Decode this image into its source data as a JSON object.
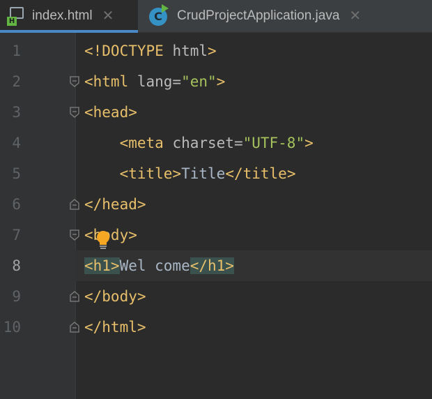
{
  "tabs": [
    {
      "label": "index.html",
      "icon": "html-file-icon",
      "active": true,
      "badge": "H"
    },
    {
      "label": "CrudProjectApplication.java",
      "icon": "java-class-icon",
      "active": false,
      "badge": "C"
    }
  ],
  "editor": {
    "current_line": 8,
    "line_numbers": [
      "1",
      "2",
      "3",
      "4",
      "5",
      "6",
      "7",
      "8",
      "9",
      "10"
    ],
    "lines": [
      {
        "tag_open": "<!DOCTYPE",
        "attr": " html",
        "tag_close": ">"
      },
      {
        "tag_open": "<html",
        "attr": " lang=",
        "str": "\"en\"",
        "tag_close": ">"
      },
      {
        "tag": "<head>"
      },
      {
        "indent": "    ",
        "tag_open": "<meta",
        "attr": " charset=",
        "str": "\"UTF-8\"",
        "tag_close": ">"
      },
      {
        "indent": "    ",
        "tag_a": "<title>",
        "text": "Title",
        "tag_b": "</title>"
      },
      {
        "tag": "</head>"
      },
      {
        "tag": "<body>"
      },
      {
        "tag_a": "<h1>",
        "text": "Wel come",
        "tag_b": "</h1>"
      },
      {
        "tag": "</body>"
      },
      {
        "tag": "</html>"
      }
    ]
  },
  "colors": {
    "tag": "#e8bf6a",
    "string": "#a5c25c",
    "text": "#a9b7c6",
    "background": "#2b2b2b",
    "tag_match": "#3b514d"
  }
}
